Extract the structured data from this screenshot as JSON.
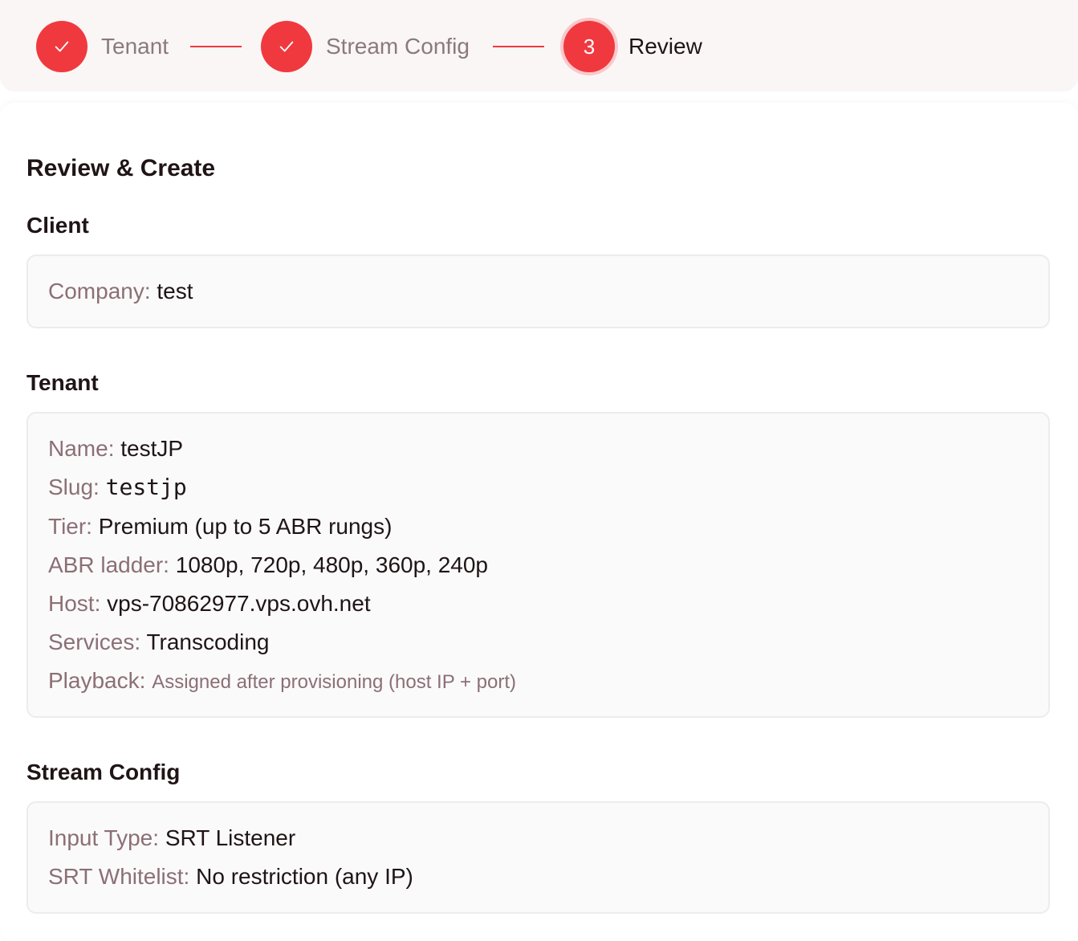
{
  "stepper": {
    "steps": [
      {
        "label": "Tenant",
        "state": "done"
      },
      {
        "label": "Stream Config",
        "state": "done"
      },
      {
        "label": "Review",
        "state": "current",
        "number": "3"
      }
    ]
  },
  "page": {
    "title": "Review & Create"
  },
  "client": {
    "title": "Client",
    "company_label": "Company:",
    "company_value": "test"
  },
  "tenant": {
    "title": "Tenant",
    "name_label": "Name:",
    "name_value": "testJP",
    "slug_label": "Slug:",
    "slug_value": "testjp",
    "tier_label": "Tier:",
    "tier_value": "Premium (up to 5 ABR rungs)",
    "abr_label": "ABR ladder:",
    "abr_value": "1080p, 720p, 480p, 360p, 240p",
    "host_label": "Host:",
    "host_value": "vps-70862977.vps.ovh.net",
    "services_label": "Services:",
    "services_value": "Transcoding",
    "playback_label": "Playback:",
    "playback_value": "Assigned after provisioning (host IP + port)"
  },
  "stream_config": {
    "title": "Stream Config",
    "input_type_label": "Input Type:",
    "input_type_value": "SRT Listener",
    "whitelist_label": "SRT Whitelist:",
    "whitelist_value": "No restriction (any IP)"
  },
  "colors": {
    "accent": "#f0393f",
    "label": "#8c6f76",
    "text": "#1f1416"
  },
  "icons": {
    "done_step": "check-icon"
  }
}
